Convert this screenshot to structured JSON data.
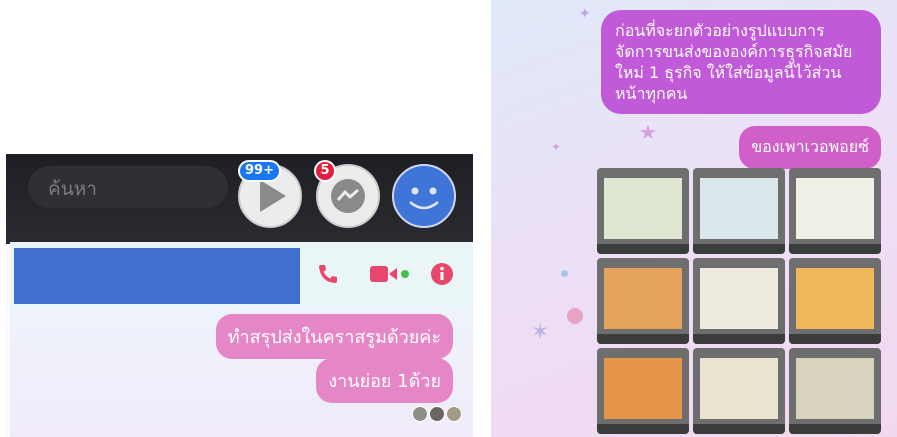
{
  "left": {
    "search": {
      "placeholder": "ค้นหา"
    },
    "badges": {
      "video_count": "99+",
      "messenger_count": "5"
    },
    "colors": {
      "bubble_pink": "#e586c6",
      "header_blue": "#416fd1",
      "accent_pink": "#e8466c",
      "profile_blue": "#3f74d8"
    },
    "chat": {
      "messages": [
        {
          "text": "ทำสรุปส่งในคราสรูมด้วยค่ะ"
        },
        {
          "text": "งานย่อย 1ด้วย"
        }
      ]
    },
    "icons": [
      "search-icon",
      "video-play-icon",
      "messenger-icon",
      "profile-avatar-icon",
      "phone-icon",
      "video-call-icon",
      "info-icon"
    ]
  },
  "right": {
    "colors": {
      "bubble_purple": "#c15ad9",
      "bubble_pink": "#d05fc9"
    },
    "messages": [
      {
        "text": "ก่อนที่จะยกตัวอย่างรูปแบบการจัดการขนส่งขององค์การธุรกิจสมัยใหม่ 1 ธุรกิจ ให้ใส่ข้อมูลนี้ไว้ส่วนหน้าทุกคน"
      },
      {
        "text": "ของเพาเวอพอยซ์"
      }
    ]
  }
}
